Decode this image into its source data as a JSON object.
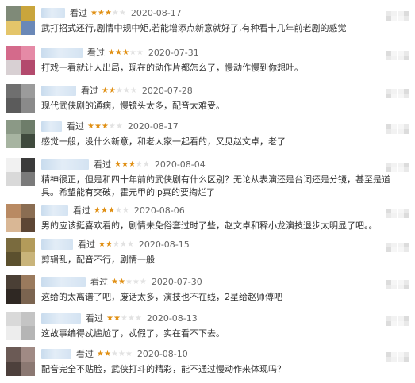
{
  "reviews": [
    {
      "status": "看过",
      "rating": 3,
      "date": "2020-08-17",
      "text": "武打招式还行,剧情中规中矩,若能增添点新意就好了,有种看十几年前老剧的感觉",
      "avatar_colors": [
        "#7f8a78",
        "#c9a53c",
        "#e4c56a",
        "#6a88b7"
      ]
    },
    {
      "status": "看过",
      "rating": 3,
      "date": "2020-07-31",
      "text": "打戏一看就让人出局，现在的动作片都怎么了，慢动作慢到你想吐。",
      "avatar_colors": [
        "#d46a8b",
        "#e58aa6",
        "#d8d0d3",
        "#b34a6d"
      ]
    },
    {
      "status": "看过",
      "rating": 2,
      "date": "2020-07-28",
      "text": "现代武侠剧的通病，慢镜头太多，配音太难受。",
      "avatar_colors": [
        "#6f6f6f",
        "#9b9b9b",
        "#5b5b5b",
        "#8a8a8a"
      ]
    },
    {
      "status": "看过",
      "rating": 3,
      "date": "2020-08-17",
      "text": "感觉一般，没什么新意，和老人家一起看的，又见赵文卓，老了",
      "avatar_colors": [
        "#8b9986",
        "#6e7d6a",
        "#a7b4a1",
        "#3f4a3d"
      ]
    },
    {
      "status": "看过",
      "rating": 3,
      "date": "2020-08-04",
      "text": "精神很正，但是和四十年前的武侠剧有什么区别？无论从表演还是台词还是分镜，甚至是道具。希望能有突破，霍元甲的ip真的要掏烂了",
      "avatar_colors": [
        "#f1f1f1",
        "#3b3b3b",
        "#d9d9d9",
        "#7a7a7a"
      ]
    },
    {
      "status": "看过",
      "rating": 3,
      "date": "2020-08-06",
      "text": "男的应该挺喜欢看的，剧情未免俗套过时了些，赵文卓和释小龙演技退步太明显了吧。。",
      "avatar_colors": [
        "#b98a63",
        "#8a6d52",
        "#d9b795",
        "#5d4634"
      ]
    },
    {
      "status": "看过",
      "rating": 2,
      "date": "2020-08-15",
      "text": "剪辑乱，配音不行，剧情一般",
      "avatar_colors": [
        "#7a6b3e",
        "#b39b5a",
        "#5b502e",
        "#c9b47a"
      ]
    },
    {
      "status": "看过",
      "rating": 2,
      "date": "2020-07-30",
      "text": "这给的太离谱了吧，废话太多，演技也不在线，2星给赵师傅吧",
      "avatar_colors": [
        "#4a3f35",
        "#9a7a5d",
        "#2f2823",
        "#7b6450"
      ]
    },
    {
      "status": "看过",
      "rating": 2,
      "date": "2020-08-13",
      "text": "这故事编得忒尴尬了，忒假了，实在看不下去。",
      "avatar_colors": [
        "#d9d9d9",
        "#c4c4c4",
        "#ededed",
        "#b5b5b5"
      ]
    },
    {
      "status": "看过",
      "rating": 2,
      "date": "2020-08-10",
      "text": "配音完全不贴脸，武侠打斗的精彩，能不通过慢动作来体现吗？",
      "avatar_colors": [
        "#6b5a55",
        "#a08a84",
        "#4d403c",
        "#8b7872"
      ]
    }
  ],
  "star_colors": {
    "on": "#e09015",
    "off": "#e2e2e2"
  }
}
